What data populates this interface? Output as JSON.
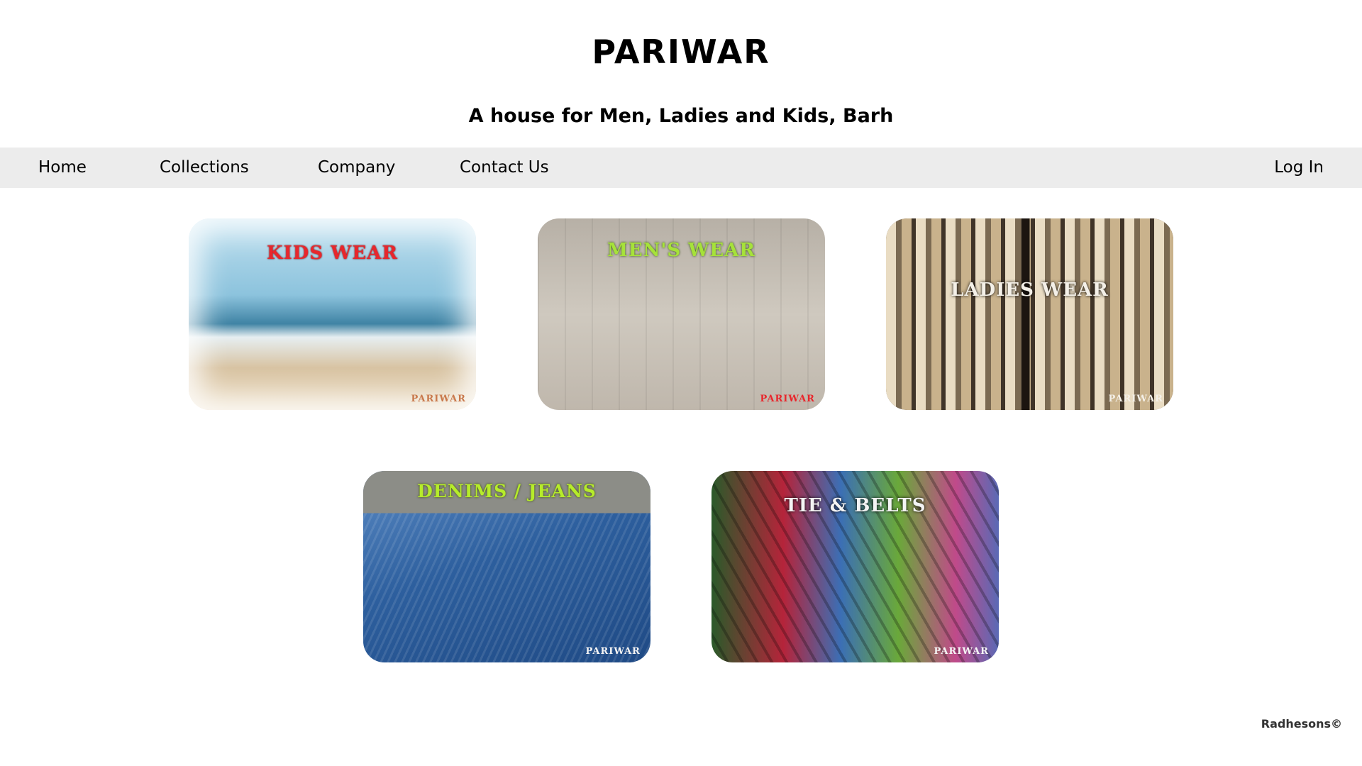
{
  "header": {
    "brand": "PARIWAR",
    "tagline": "A house for Men, Ladies and Kids, Barh"
  },
  "nav": {
    "home": "Home",
    "collections": "Collections",
    "company": "Company",
    "contact": "Contact Us",
    "login": "Log In"
  },
  "cards": [
    {
      "title": "KIDS WEAR",
      "mark": "PARIWAR"
    },
    {
      "title": "MEN'S WEAR",
      "mark": "PARIWAR"
    },
    {
      "title": "LADIES WEAR",
      "mark": "PARIWAR"
    },
    {
      "title": "DENIMS / JEANS",
      "mark": "PARIWAR"
    },
    {
      "title": "TIE & BELTS",
      "mark": "PARIWAR"
    }
  ],
  "footer": {
    "credit": "Radhesons©"
  },
  "colors": {
    "nav_background": "#ececec",
    "kids_title": "#e8262c",
    "mens_title": "#a6e23a",
    "denim_title": "#b6ec2a"
  }
}
